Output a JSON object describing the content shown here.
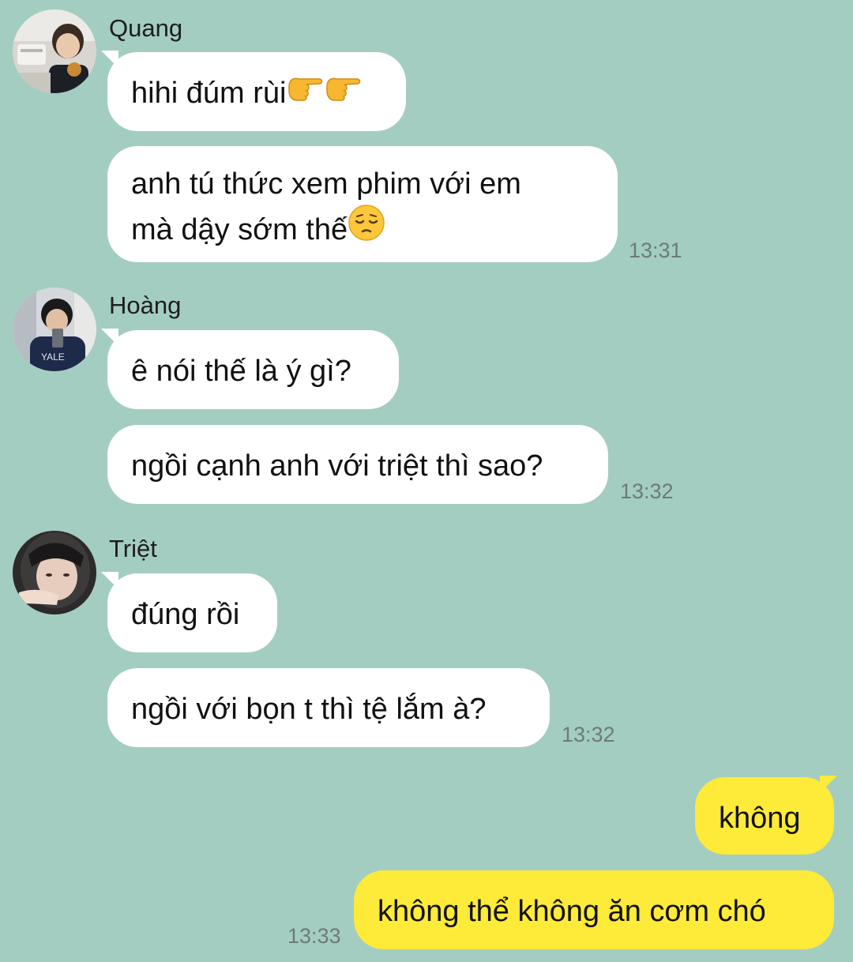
{
  "groups": [
    {
      "sender": "Quang",
      "avatar": "avatar-quang",
      "messages": [
        {
          "text": "hihi đúm rùi",
          "emoji": [
            "pointing-right-emoji",
            "pointing-right-emoji"
          ]
        },
        {
          "line1": "anh tú thức xem phim với em",
          "line2": "mà dậy sớm thế",
          "emoji": [
            "pensive-face-emoji"
          ],
          "time": "13:31"
        }
      ]
    },
    {
      "sender": "Hoàng",
      "avatar": "avatar-hoang",
      "messages": [
        {
          "text": "ê nói thế là ý gì?"
        },
        {
          "text": "ngồi cạnh anh với triệt thì sao?",
          "time": "13:32"
        }
      ]
    },
    {
      "sender": "Triệt",
      "avatar": "avatar-triet",
      "messages": [
        {
          "text": "đúng rồi"
        },
        {
          "text": "ngồi với bọn t thì tệ lắm à?",
          "time": "13:32"
        }
      ]
    }
  ],
  "outgoing": [
    {
      "text": "không"
    },
    {
      "text": "không thể không ăn cơm chó",
      "time": "13:33"
    }
  ],
  "colors": {
    "background": "#a4cdc1",
    "incoming_bubble": "#ffffff",
    "outgoing_bubble": "#feea38",
    "timestamp": "#6c7b77"
  }
}
